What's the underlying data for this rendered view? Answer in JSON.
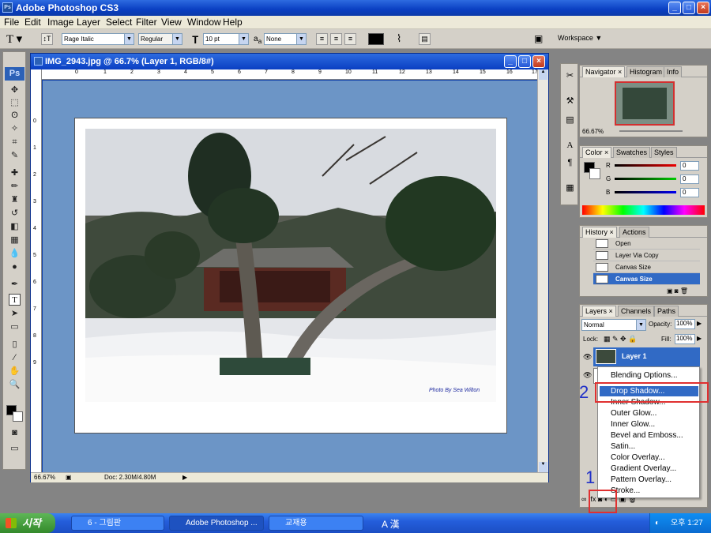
{
  "app": {
    "title": "Adobe Photoshop CS3",
    "ps_logo": "Ps"
  },
  "menu": [
    "File",
    "Edit",
    "Image",
    "Layer",
    "Select",
    "Filter",
    "View",
    "Window",
    "Help"
  ],
  "options": {
    "font_family": "Rage Italic",
    "font_style": "Regular",
    "font_size": "10 pt",
    "aa_label": "a",
    "aa_mode": "None",
    "workspace": "Workspace ▼",
    "text_color": "#000000"
  },
  "document": {
    "title": "IMG_2943.jpg @ 66.7% (Layer 1, RGB/8#)",
    "zoom": "66.67%",
    "doc_info": "Doc: 2.30M/4.80M",
    "watermark": "Photo By Sea Wilton",
    "ruler_h": [
      "0",
      "1",
      "2",
      "3",
      "4",
      "5",
      "6",
      "7",
      "8",
      "9",
      "10",
      "11",
      "12",
      "13",
      "14",
      "15",
      "16",
      "17"
    ],
    "ruler_v": [
      "0",
      "1",
      "2",
      "3",
      "4",
      "5",
      "6",
      "7",
      "8",
      "9"
    ]
  },
  "navigator": {
    "tabs": [
      "Navigator",
      "Histogram",
      "Info"
    ],
    "zoom": "66.67%"
  },
  "color_panel": {
    "tabs": [
      "Color",
      "Swatches",
      "Styles"
    ],
    "r": "0",
    "g": "0",
    "b": "0",
    "r_label": "R",
    "g_label": "G",
    "b_label": "B"
  },
  "history": {
    "tabs": [
      "History",
      "Actions"
    ],
    "items": [
      "Open",
      "Layer Via Copy",
      "Canvas Size",
      "Canvas Size"
    ],
    "selected_index": 3
  },
  "layers": {
    "tabs": [
      "Layers",
      "Channels",
      "Paths"
    ],
    "blend_mode": "Normal",
    "opacity_label": "Opacity:",
    "opacity": "100%",
    "lock_label": "Lock:",
    "fill_label": "Fill:",
    "fill": "100%",
    "layer_name": "Layer 1"
  },
  "context_menu": {
    "items": [
      "Blending Options...",
      "Drop Shadow...",
      "Inner Shadow...",
      "Outer Glow...",
      "Inner Glow...",
      "Bevel and Emboss...",
      "Satin...",
      "Color Overlay...",
      "Gradient Overlay...",
      "Pattern Overlay...",
      "Stroke..."
    ],
    "highlighted_index": 1
  },
  "annotations": {
    "step1": "1",
    "step2": "2",
    "color": "#e03030"
  },
  "taskbar": {
    "start": "시작",
    "tasks": [
      "6 - 그림판",
      "Adobe Photoshop ...",
      "교재용"
    ],
    "ime": "A 漢",
    "clock": "오후 1:27"
  }
}
